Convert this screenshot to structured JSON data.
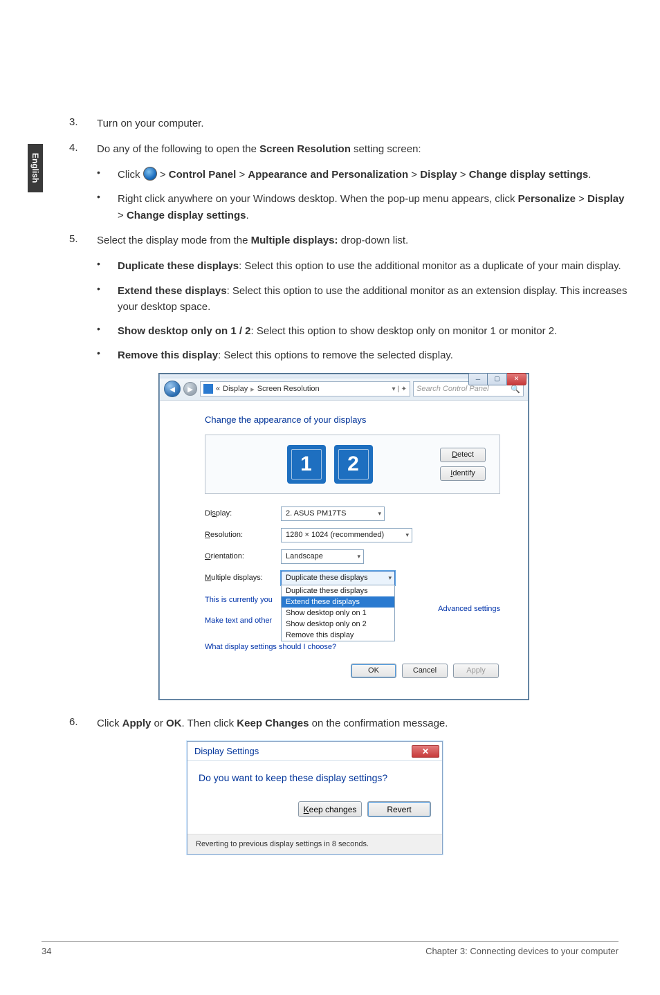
{
  "sidebar": {
    "lang": "English"
  },
  "steps": {
    "s3": {
      "num": "3.",
      "text": "Turn on your computer."
    },
    "s4": {
      "num": "4.",
      "text_a": "Do any of the following to open the ",
      "bold1": "Screen Resolution",
      "text_b": " setting screen:",
      "b1_a": "Click ",
      "b1_b": " > ",
      "b1_cp": "Control Panel",
      "b1_c": " > ",
      "b1_ap": "Appearance and Personalization",
      "b1_d": " > ",
      "b1_dp": "Display",
      "b1_e": " > ",
      "b1_cd": "Change display settings",
      "b1_f": ".",
      "b2_a": "Right click anywhere on your Windows desktop. When the pop-up menu appears, click ",
      "b2_p": "Personalize",
      "b2_b": " > ",
      "b2_d": "Display",
      "b2_c": " > ",
      "b2_cd": "Change display settings",
      "b2_e": "."
    },
    "s5": {
      "num": "5.",
      "text_a": "Select the display mode from the ",
      "bold1": "Multiple displays:",
      "text_b": " drop-down list.",
      "opt1_t": "Duplicate these displays",
      "opt1_d": ": Select this option to use the additional monitor as a duplicate of your main display.",
      "opt2_t": "Extend these displays",
      "opt2_d": ": Select this option to use the additional monitor as an extension display. This increases your desktop space.",
      "opt3_t": "Show desktop only on 1 / 2",
      "opt3_d": ": Select this option to show desktop only on monitor 1 or monitor 2.",
      "opt4_t": "Remove this display",
      "opt4_d": ": Select this options to remove the selected display."
    },
    "s6": {
      "num": "6.",
      "a": "Click ",
      "apply": "Apply",
      "b": " or ",
      "ok": "OK",
      "c": ". Then click ",
      "kc": "Keep Changes",
      "d": " on the confirmation message."
    }
  },
  "srwin": {
    "bc_display": "Display",
    "bc_sr": "Screen Resolution",
    "search_ph": "Search Control Panel",
    "heading": "Change the appearance of your displays",
    "mon1": "1",
    "mon2": "2",
    "detect": "Detect",
    "identify": "Identify",
    "lbl_display": "Display:",
    "val_display": "2. ASUS PM17TS",
    "lbl_res": "Resolution:",
    "val_res": "1280 × 1024 (recommended)",
    "lbl_orient": "Orientation:",
    "val_orient": "Landscape",
    "lbl_multi": "Multiple displays:",
    "val_multi": "Duplicate these displays",
    "dd1": "Duplicate these displays",
    "dd2": "Extend these displays",
    "dd3": "Show desktop only on 1",
    "dd4": "Show desktop only on 2",
    "dd5": "Remove this display",
    "note1": "This is currently you",
    "note2": "Make text and other",
    "link_what": "What display settings should I choose?",
    "adv": "Advanced settings",
    "ok": "OK",
    "cancel": "Cancel",
    "apply": "Apply"
  },
  "dswin": {
    "title": "Display Settings",
    "q": "Do you want to keep these display settings?",
    "keep": "Keep changes",
    "revert": "Revert",
    "foot": "Reverting to previous display settings in 8 seconds."
  },
  "footer": {
    "page": "34",
    "chapter": "Chapter 3: Connecting devices to your computer"
  }
}
